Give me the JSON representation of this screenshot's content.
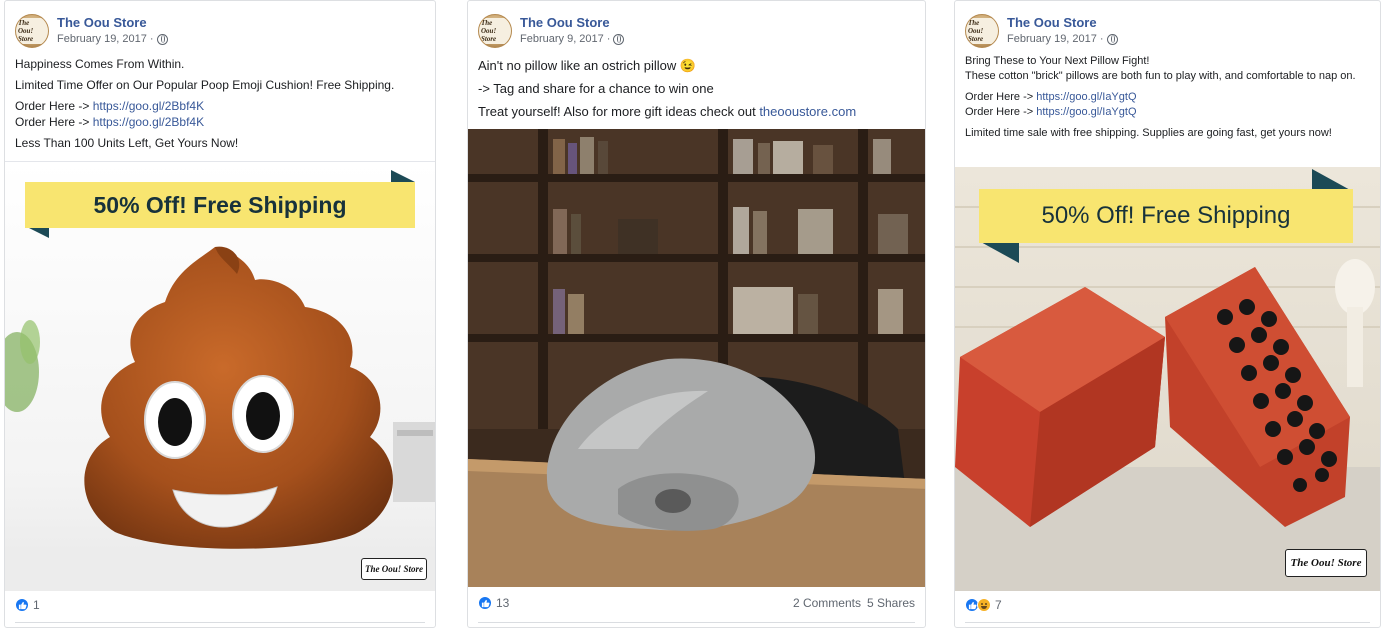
{
  "page_name": "The Oou Store",
  "avatar_text": "The Oou! Store",
  "posts": [
    {
      "date": "February 19, 2017",
      "lines": [
        "Happiness Comes From Within.",
        "Limited Time Offer on Our Popular Poop Emoji Cushion! Free Shipping.",
        "Order Here -> ",
        "Order Here -> ",
        "Less Than 100 Units Left, Get Yours Now!"
      ],
      "link": "https://goo.gl/2Bbf4K",
      "banner_text": "50% Off! Free Shipping",
      "stamp_text": "The Oou! Store",
      "reaction_count": "1"
    },
    {
      "date": "February 9, 2017",
      "lines": [
        "Ain't no pillow like an ostrich pillow 😉",
        "-> Tag and share for a chance to win one",
        "Treat yourself! Also for more gift ideas check out "
      ],
      "link": "theooustore.com",
      "reaction_count": "13",
      "comments": "2 Comments",
      "shares": "5 Shares"
    },
    {
      "date": "February 19, 2017",
      "lines": [
        "Bring These to Your Next Pillow Fight!",
        "These cotton \"brick\" pillows are both fun to play with, and comfortable to nap on.",
        "Order Here -> ",
        "Order Here -> ",
        "Limited time sale with free shipping. Supplies are going fast, get yours now!"
      ],
      "link": "https://goo.gl/IaYgtQ",
      "banner_text": "50% Off! Free Shipping",
      "stamp_text": "The Oou! Store",
      "reaction_count": "7"
    }
  ],
  "icons": {
    "globe": "globe-icon",
    "like": "like-reaction-icon",
    "haha": "haha-reaction-icon"
  },
  "colors": {
    "link": "#385898",
    "banner": "#f8e570",
    "banner_text": "#17323b",
    "banner_fold": "#1c4a56",
    "like": "#1877f2"
  }
}
